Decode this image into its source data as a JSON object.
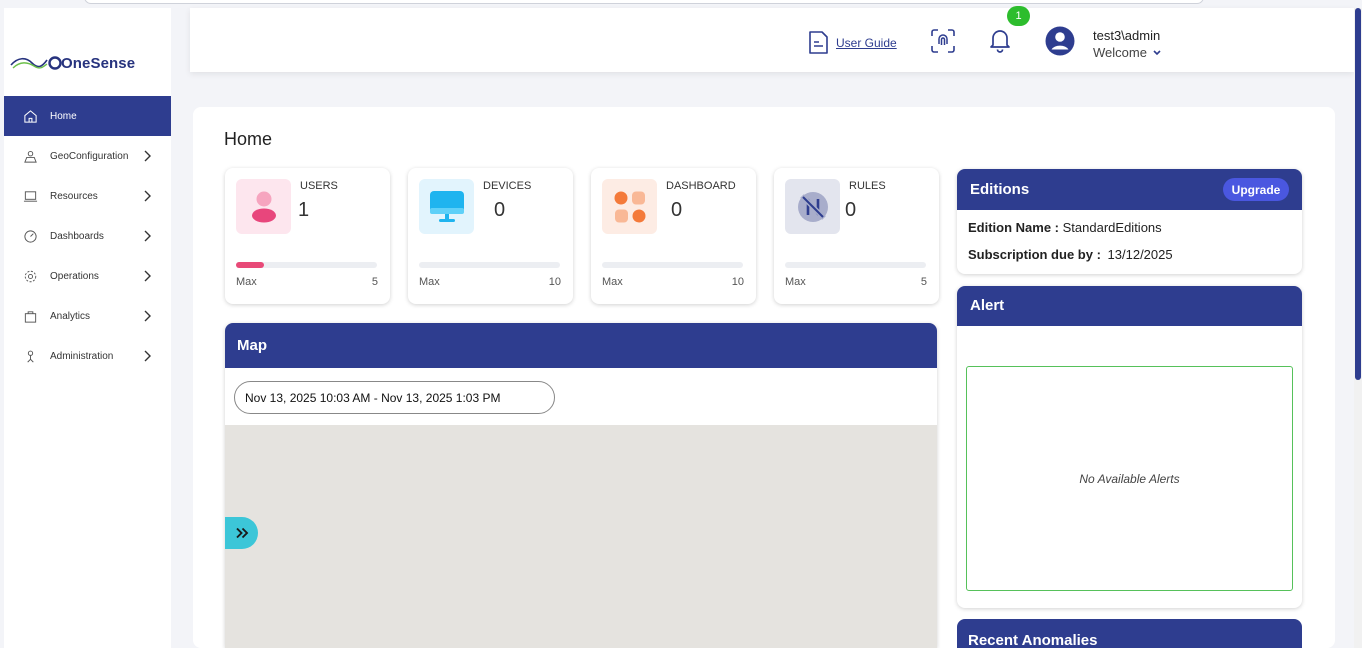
{
  "app": {
    "logo_text": "OneSense"
  },
  "sidebar": {
    "items": [
      {
        "label": "Home",
        "icon": "home-icon"
      },
      {
        "label": "GeoConfiguration",
        "icon": "map-user-icon"
      },
      {
        "label": "Resources",
        "icon": "laptop-icon"
      },
      {
        "label": "Dashboards",
        "icon": "gauge-icon"
      },
      {
        "label": "Operations",
        "icon": "gear-icon"
      },
      {
        "label": "Analytics",
        "icon": "bag-icon"
      },
      {
        "label": "Administration",
        "icon": "admin-icon"
      }
    ]
  },
  "header": {
    "user_guide": "User Guide",
    "notification_count": "1",
    "user_name": "test3\\admin",
    "welcome": "Welcome"
  },
  "page": {
    "title": "Home"
  },
  "stats": [
    {
      "label": "USERS",
      "value": "1",
      "max_label": "Max",
      "max": "5",
      "progress": 0.2
    },
    {
      "label": "DEVICES",
      "value": "0",
      "max_label": "Max",
      "max": "10",
      "progress": 0
    },
    {
      "label": "DASHBOARD",
      "value": "0",
      "max_label": "Max",
      "max": "10",
      "progress": 0
    },
    {
      "label": "RULES",
      "value": "0",
      "max_label": "Max",
      "max": "5",
      "progress": 0
    }
  ],
  "map": {
    "title": "Map",
    "date_range": "Nov 13, 2025 10:03 AM - Nov 13, 2025 1:03 PM"
  },
  "editions": {
    "title": "Editions",
    "upgrade_label": "Upgrade",
    "name_label": "Edition Name :",
    "name_value": "StandardEditions",
    "due_label": "Subscription due by :",
    "due_value": "13/12/2025"
  },
  "alert": {
    "title": "Alert",
    "empty_text": "No Available Alerts"
  },
  "anomalies": {
    "title": "Recent Anomalies"
  },
  "colors": {
    "primary": "#2e3d8f",
    "accent_pink": "#e84a78",
    "badge_green": "#2dbd2d",
    "expand_cyan": "#3cc6d8"
  }
}
